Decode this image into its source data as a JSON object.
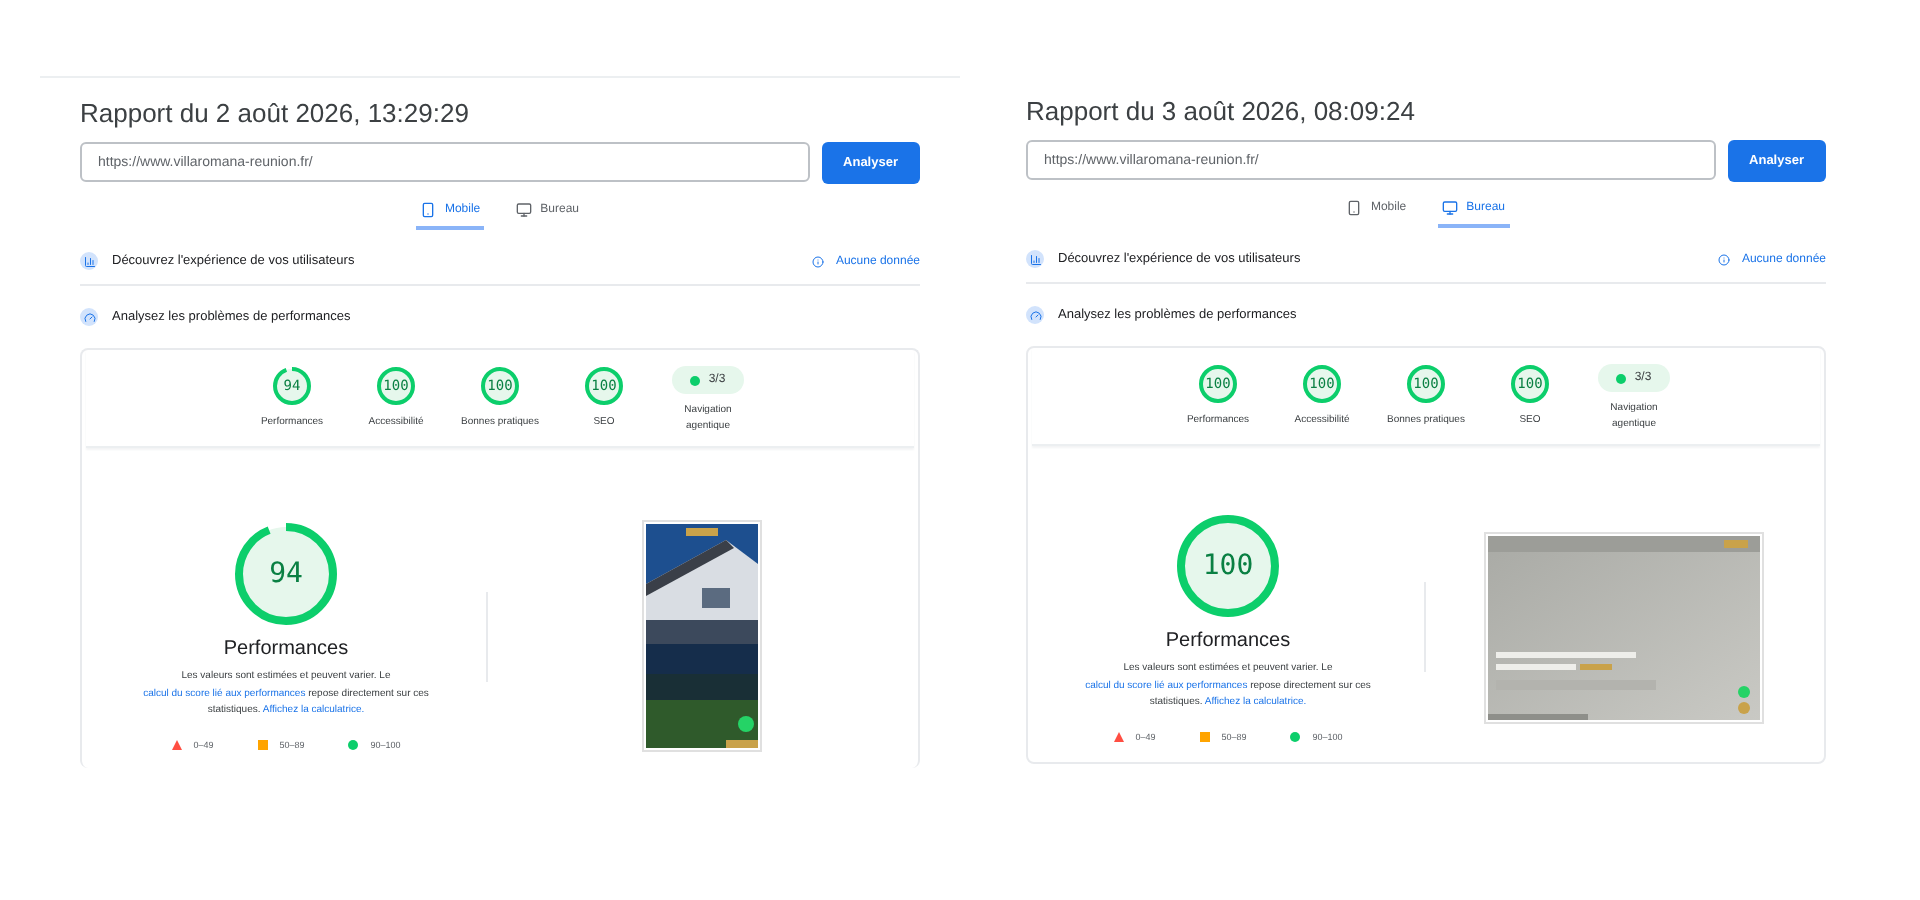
{
  "reports": [
    {
      "title": "Rapport du 2 août 2026, 13:29:29",
      "url": "https://www.villaromana-reunion.fr/",
      "button": "Analyser",
      "tabs": [
        {
          "label": "Mobile",
          "kind": "mobile",
          "selected": true
        },
        {
          "label": "Bureau",
          "kind": "desktop",
          "selected": false
        }
      ],
      "users": {
        "label": "Découvrez l'expérience de vos utilisateurs",
        "status": "Aucune donnée"
      },
      "diagnose": {
        "label": "Analysez les problèmes de performances"
      },
      "scores": [
        {
          "value": "94",
          "label": "Performances",
          "level": 0.94
        },
        {
          "value": "100",
          "label": "Accessibilité",
          "level": 1
        },
        {
          "value": "100",
          "label": "Bonnes pratiques",
          "level": 1
        },
        {
          "value": "100",
          "label": "SEO",
          "level": 1
        }
      ],
      "nav": {
        "value": "3/3",
        "label": "Navigation agentique"
      },
      "main": {
        "value": "94",
        "level": 0.94,
        "title": "Performances",
        "note": [
          {
            "text": "Les valeurs sont estimées et peuvent varier. Le ",
            "link": false
          },
          {
            "text": "calcul du score lié aux performances",
            "link": true
          },
          {
            "text": " repose directement sur ces statistiques. ",
            "link": false
          },
          {
            "text": "Affichez la calculatrice.",
            "link": true
          }
        ]
      },
      "legend": [
        {
          "kind": "fail",
          "range": "0–49"
        },
        {
          "kind": "average",
          "range": "50–89"
        },
        {
          "kind": "pass",
          "range": "90–100"
        }
      ],
      "preview": {
        "kind": "picture"
      }
    },
    {
      "title": "Rapport du 3 août 2026, 08:09:24",
      "url": "https://www.villaromana-reunion.fr/",
      "button": "Analyser",
      "tabs": [
        {
          "label": "Mobile",
          "kind": "mobile",
          "selected": false
        },
        {
          "label": "Bureau",
          "kind": "desktop",
          "selected": true
        }
      ],
      "users": {
        "label": "Découvrez l'expérience de vos utilisateurs",
        "status": "Aucune donnée"
      },
      "diagnose": {
        "label": "Analysez les problèmes de performances"
      },
      "scores": [
        {
          "value": "100",
          "label": "Performances",
          "level": 1
        },
        {
          "value": "100",
          "label": "Accessibilité",
          "level": 1
        },
        {
          "value": "100",
          "label": "Bonnes pratiques",
          "level": 1
        },
        {
          "value": "100",
          "label": "SEO",
          "level": 1
        }
      ],
      "nav": {
        "value": "3/3",
        "label": "Navigation agentique"
      },
      "main": {
        "value": "100",
        "level": 1,
        "title": "Performances",
        "note": [
          {
            "text": "Les valeurs sont estimées et peuvent varier. Le ",
            "link": false
          },
          {
            "text": "calcul du score lié aux performances",
            "link": true
          },
          {
            "text": " repose directement sur ces statistiques. ",
            "link": false
          },
          {
            "text": "Affichez la calculatrice.",
            "link": true
          }
        ]
      },
      "legend": [
        {
          "kind": "fail",
          "range": "0–49"
        },
        {
          "kind": "average",
          "range": "50–89"
        },
        {
          "kind": "pass",
          "range": "90–100"
        }
      ],
      "preview": {
        "kind": "picture"
      }
    }
  ]
}
